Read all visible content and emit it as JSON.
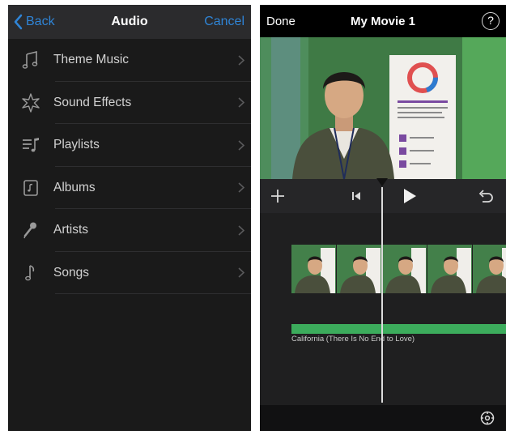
{
  "audio_menu": {
    "back_label": "Back",
    "title": "Audio",
    "cancel_label": "Cancel",
    "items": [
      {
        "label": "Theme Music",
        "icon": "music-note-icon"
      },
      {
        "label": "Sound Effects",
        "icon": "star-burst-icon"
      },
      {
        "label": "Playlists",
        "icon": "playlist-icon"
      },
      {
        "label": "Albums",
        "icon": "album-icon"
      },
      {
        "label": "Artists",
        "icon": "microphone-icon"
      },
      {
        "label": "Songs",
        "icon": "music-note-icon"
      }
    ]
  },
  "editor": {
    "done_label": "Done",
    "title": "My Movie 1",
    "help_label": "?",
    "audio_track_label": "California (There Is No End to Love)"
  },
  "colors": {
    "accent": "#2f84d6",
    "audio_track": "#3cac5c",
    "panel_background": "#1a1a1a"
  }
}
